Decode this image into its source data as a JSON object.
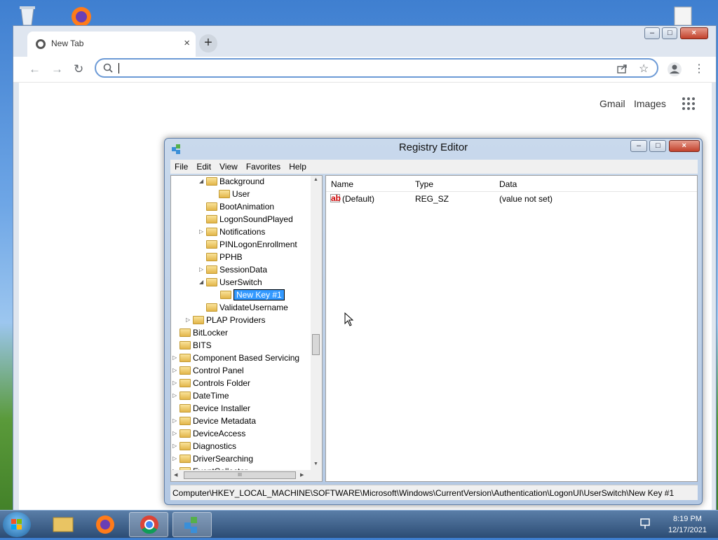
{
  "desktop": {
    "icons": [
      "recycle-bin-icon",
      "firefox-icon",
      "file-icon"
    ]
  },
  "browser": {
    "tab_title": "New Tab",
    "tab_close": "×",
    "new_tab": "+",
    "omnibox_value": "",
    "links": {
      "gmail": "Gmail",
      "images": "Images"
    },
    "accent_color": "#6c9ad6"
  },
  "window_controls": {
    "minimize": "–",
    "maximize": "□",
    "close": "×"
  },
  "regedit": {
    "title": "Registry Editor",
    "menu": [
      "File",
      "Edit",
      "View",
      "Favorites",
      "Help"
    ],
    "tree": [
      {
        "label": "Background",
        "expander": "◢"
      },
      {
        "label": "User",
        "expander": ""
      },
      {
        "label": "BootAnimation",
        "expander": ""
      },
      {
        "label": "LogonSoundPlayed",
        "expander": ""
      },
      {
        "label": "Notifications",
        "expander": "▷"
      },
      {
        "label": "PINLogonEnrollment",
        "expander": ""
      },
      {
        "label": "PPHB",
        "expander": ""
      },
      {
        "label": "SessionData",
        "expander": "▷"
      },
      {
        "label": "UserSwitch",
        "expander": "◢"
      },
      {
        "label": "New Key #1",
        "expander": ""
      },
      {
        "label": "ValidateUsername",
        "expander": ""
      },
      {
        "label": "PLAP Providers",
        "expander": "▷"
      },
      {
        "label": "BitLocker",
        "expander": ""
      },
      {
        "label": "BITS",
        "expander": ""
      },
      {
        "label": "Component Based Servicing",
        "expander": "▷"
      },
      {
        "label": "Control Panel",
        "expander": "▷"
      },
      {
        "label": "Controls Folder",
        "expander": "▷"
      },
      {
        "label": "DateTime",
        "expander": "▷"
      },
      {
        "label": "Device Installer",
        "expander": ""
      },
      {
        "label": "Device Metadata",
        "expander": "▷"
      },
      {
        "label": "DeviceAccess",
        "expander": "▷"
      },
      {
        "label": "Diagnostics",
        "expander": "▷"
      },
      {
        "label": "DriverSearching",
        "expander": "▷"
      },
      {
        "label": "EventCollector",
        "expander": "▷"
      }
    ],
    "scroll_arrows": {
      "up": "▲",
      "down": "▼",
      "left": "◀",
      "right": "▶",
      "grip": "III"
    },
    "columns": {
      "name": "Name",
      "type": "Type",
      "data": "Data"
    },
    "values": [
      {
        "icon_text": "ab",
        "name": "(Default)",
        "type": "REG_SZ",
        "data": "(value not set)"
      }
    ],
    "status": "Computer\\HKEY_LOCAL_MACHINE\\SOFTWARE\\Microsoft\\Windows\\CurrentVersion\\Authentication\\LogonUI\\UserSwitch\\New Key #1"
  },
  "taskbar": {
    "items": [
      "file-explorer-icon",
      "firefox-icon",
      "chrome-icon",
      "regedit-icon"
    ],
    "time": "8:19 PM",
    "date": "12/17/2021"
  }
}
